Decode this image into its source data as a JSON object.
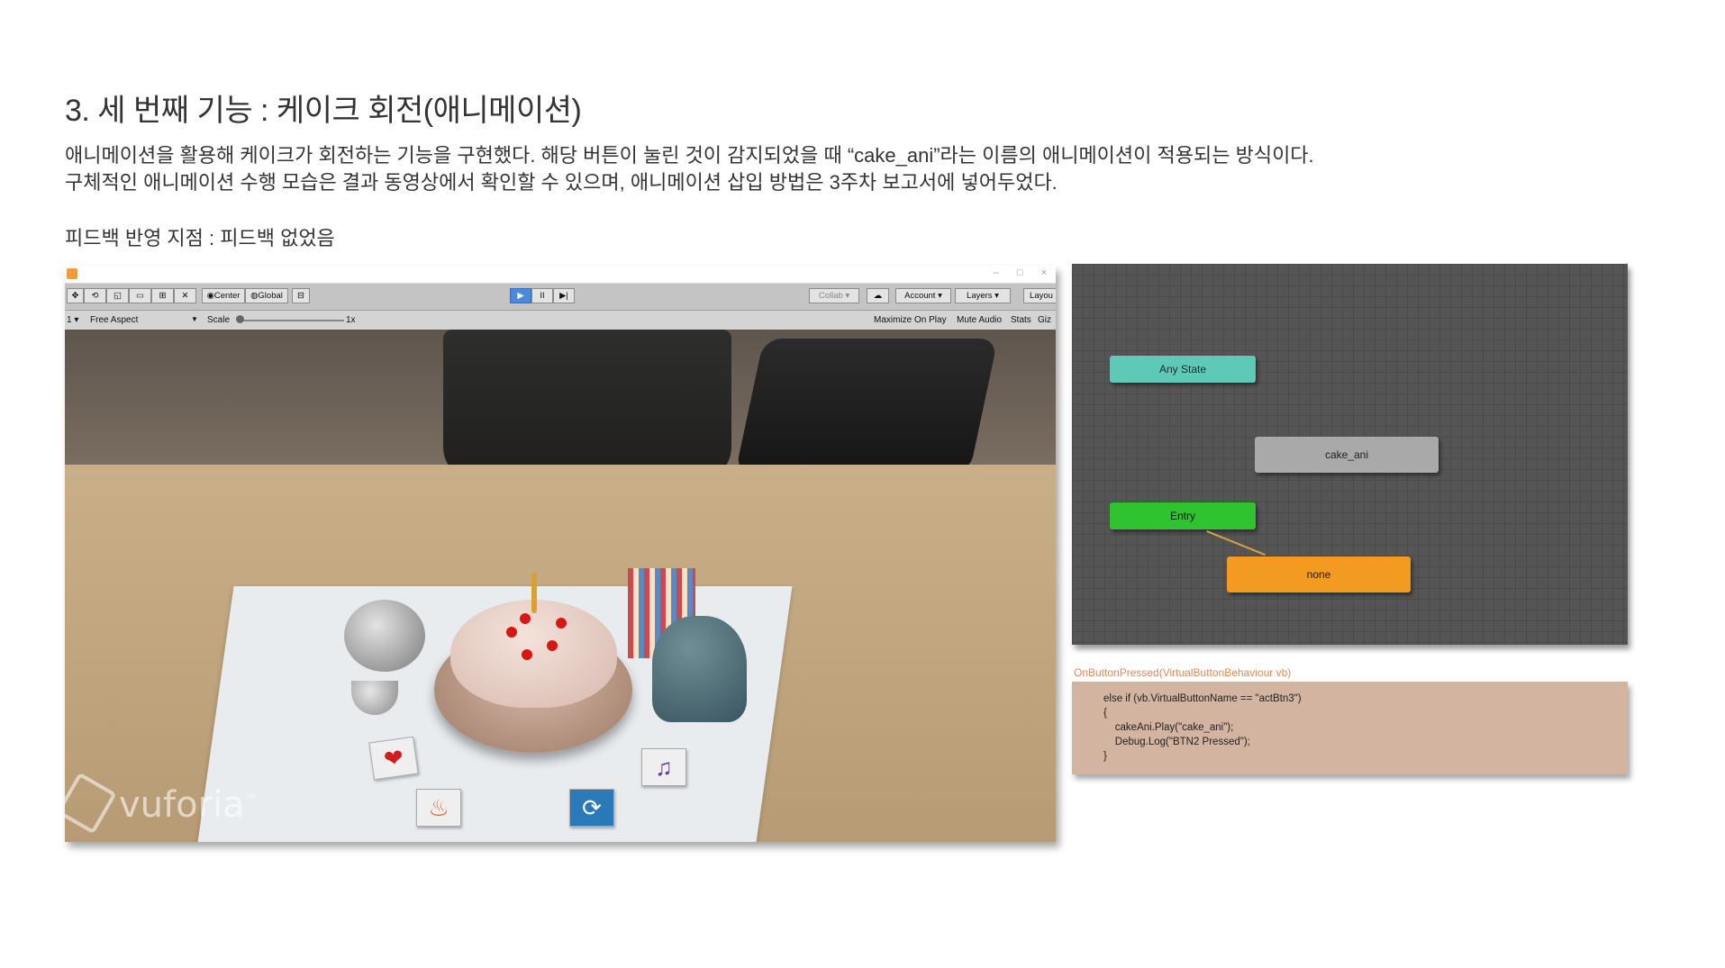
{
  "heading": "3. 세 번째 기능 : 케이크 회전(애니메이션)",
  "description": {
    "line1": "애니메이션을 활용해 케이크가 회전하는 기능을 구현했다. 해당 버튼이 눌린 것이 감지되었을 때 “cake_ani”라는 이름의 애니메이션이 적용되는 방식이다.",
    "line2": "구체적인 애니메이션 수행 모습은 결과 동영상에서 확인할 수 있으며, 애니메이션 삽입 방법은 3주차 보고서에 넣어두었다."
  },
  "feedback": "피드백 반영 지점 : 피드백 없었음",
  "unity": {
    "window_controls": [
      "–",
      "□",
      "×"
    ],
    "toolbar": {
      "center_label": "Center",
      "global_label": "Global",
      "collab_label": "Collab ▾",
      "account_label": "Account ▾",
      "layers_label": "Layers ▾",
      "layout_label": "Layou",
      "play_icon": "▶",
      "pause_icon": "II",
      "step_icon": "▶|"
    },
    "gamebar": {
      "display_label": "1 ▾",
      "aspect_label": "Free Aspect",
      "scale_label": "Scale",
      "scale_value": "1x",
      "maximize_label": "Maximize On Play",
      "mute_label": "Mute Audio",
      "stats_label": "Stats",
      "gizmos_label": "Giz"
    },
    "watermark": "vuforia",
    "watermark_tm": "™"
  },
  "animator": {
    "nodes": {
      "any_state": "Any State",
      "cake_ani": "cake_ani",
      "entry": "Entry",
      "none": "none"
    },
    "colors": {
      "any_state": "#5fc9b8",
      "cake_ani": "#a9a9a9",
      "entry": "#2fc42f",
      "none": "#f39b20"
    }
  },
  "code": {
    "title": "OnButtonPressed(VirtualButtonBehaviour vb)",
    "lines": [
      "else if (vb.VirtualButtonName == \"actBtn3\")",
      "{",
      "    cakeAni.Play(\"cake_ani\");",
      "    Debug.Log(\"BTN2 Pressed\");",
      "}"
    ]
  }
}
